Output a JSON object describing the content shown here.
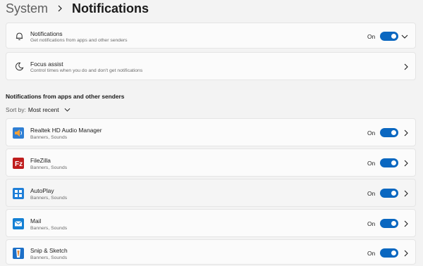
{
  "breadcrumb": {
    "parent": "System",
    "current": "Notifications"
  },
  "settings": [
    {
      "title": "Notifications",
      "subtitle": "Get notifications from apps and other senders",
      "state": "On",
      "icon": "bell-icon"
    },
    {
      "title": "Focus assist",
      "subtitle": "Control times when you do and don't get notifications",
      "icon": "moon-icon"
    }
  ],
  "section": {
    "heading": "Notifications from apps and other senders",
    "sort_label": "Sort by:",
    "sort_value": "Most recent"
  },
  "apps": [
    {
      "name": "Realtek HD Audio Manager",
      "detail": "Banners, Sounds",
      "state": "On",
      "icon": "speaker-app-icon"
    },
    {
      "name": "FileZilla",
      "detail": "Banners, Sounds",
      "state": "On",
      "icon": "filezilla-app-icon"
    },
    {
      "name": "AutoPlay",
      "detail": "Banners, Sounds",
      "state": "On",
      "icon": "autoplay-app-icon"
    },
    {
      "name": "Mail",
      "detail": "Banners, Sounds",
      "state": "On",
      "icon": "mail-app-icon"
    },
    {
      "name": "Snip & Sketch",
      "detail": "Banners, Sounds",
      "state": "On",
      "icon": "snip-sketch-app-icon"
    }
  ],
  "colors": {
    "accent": "#0a67c0",
    "background": "#f3f3f3",
    "card": "#fbfbfb"
  }
}
